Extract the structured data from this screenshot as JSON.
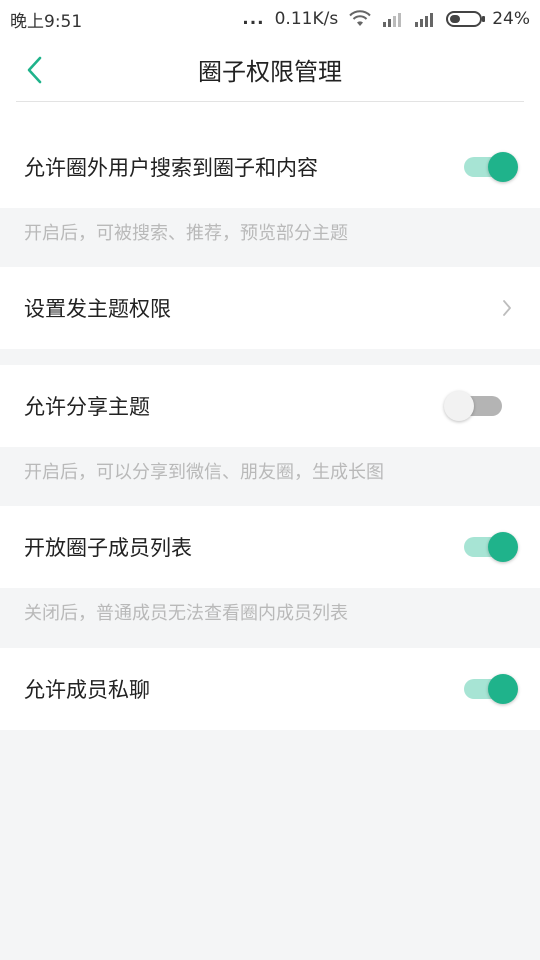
{
  "status": {
    "time": "晚上9:51",
    "dots": "...",
    "speed": "0.11K/s",
    "battery": "24%"
  },
  "nav": {
    "title": "圈子权限管理"
  },
  "settings": {
    "search": {
      "label": "允许圈外用户搜索到圈子和内容",
      "enabled": true,
      "hint": "开启后，可被搜索、推荐，预览部分主题"
    },
    "topic_perm": {
      "label": "设置发主题权限"
    },
    "share": {
      "label": "允许分享主题",
      "enabled": false,
      "hint": "开启后，可以分享到微信、朋友圈，生成长图"
    },
    "members": {
      "label": "开放圈子成员列表",
      "enabled": true,
      "hint": "关闭后，普通成员无法查看圈内成员列表"
    },
    "chat": {
      "label": "允许成员私聊",
      "enabled": true
    }
  },
  "colors": {
    "accent": "#1fb38b",
    "accent_track": "#a7e4d4",
    "background": "#f4f5f6"
  }
}
